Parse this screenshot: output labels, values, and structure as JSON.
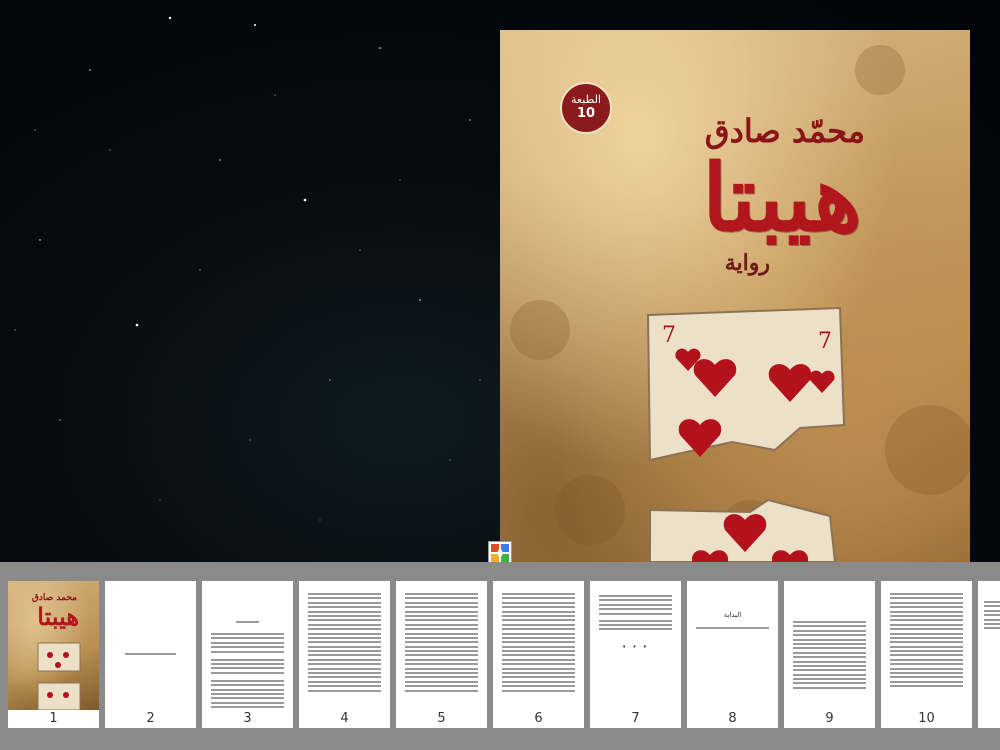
{
  "cover": {
    "author": "محمّد صادق",
    "title": "هيبتا",
    "genre": "رواية",
    "edition_label": "الطبعة",
    "edition_number": "10"
  },
  "thumbnails": {
    "cover_thumb": {
      "author": "محمد صادق",
      "title": "هيبتا"
    },
    "page8_heading": "البداية",
    "page_numbers": [
      "1",
      "2",
      "3",
      "4",
      "5",
      "6",
      "7",
      "8",
      "9",
      "10",
      ""
    ]
  },
  "icons": {
    "center_icon": "app-switch-icon"
  },
  "colors": {
    "title_red": "#b0161c",
    "strip_gray": "#8a8a8a"
  }
}
